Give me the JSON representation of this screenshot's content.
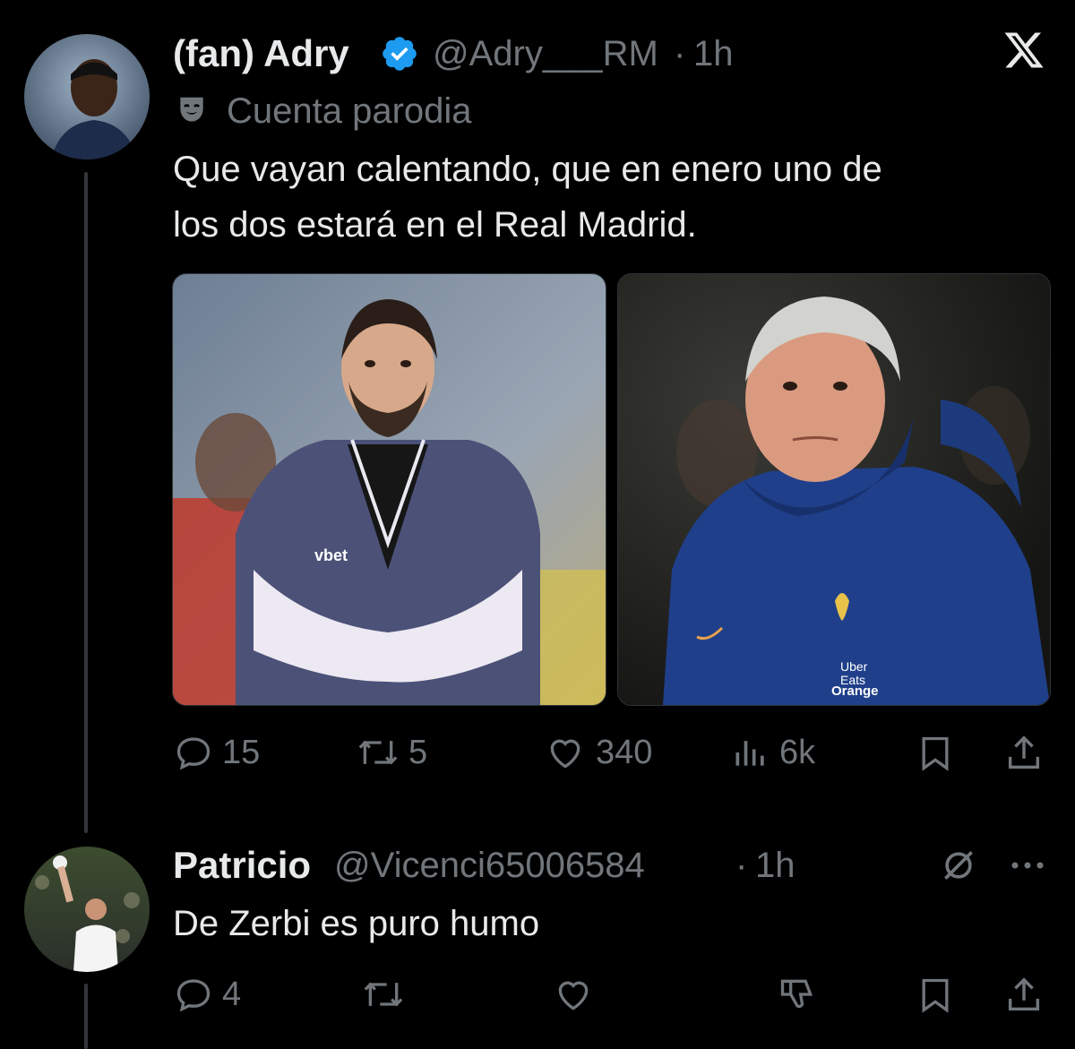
{
  "tweet": {
    "display_name": "(fan) Adry",
    "handle": "@Adry___RM",
    "separator": "·",
    "time": "1h",
    "parody_label": "Cuenta parodia",
    "text_line1": "Que vayan calentando, que en enero uno de",
    "text_line2": "los dos estará en el Real Madrid.",
    "media": {
      "left_photo_icon": "photo-coach-tracksuit",
      "right_photo_icon": "photo-coach-france-jacket",
      "left_jacket_text": "vbet",
      "right_jacket_text1": "Uber",
      "right_jacket_text2": "Eats",
      "right_jacket_text3": "Orange"
    },
    "stats": {
      "replies": "15",
      "reposts": "5",
      "likes": "340",
      "views": "6k"
    }
  },
  "reply": {
    "display_name": "Patricio",
    "handle": "@Vicenci65006584",
    "separator": "·",
    "time": "1h",
    "text": "De Zerbi es puro humo",
    "stats": {
      "replies": "4"
    }
  },
  "icons": {
    "brand": "x-logo-icon",
    "verified": "verified-badge-icon",
    "parody": "parody-mask-icon",
    "more": "more-icon",
    "grok": "grok-icon"
  },
  "colors": {
    "background": "#000000",
    "text": "#e7e9ea",
    "muted": "#71767b",
    "verified": "#1d9bf0"
  }
}
